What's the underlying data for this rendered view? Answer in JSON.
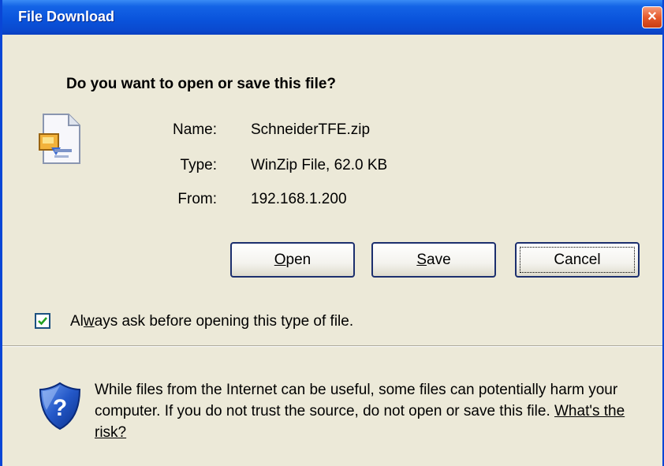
{
  "window": {
    "title": "File Download",
    "close_glyph": "×"
  },
  "dialog": {
    "question": "Do you want to open or save this file?",
    "file_icon": "winzip-file-icon",
    "fields": {
      "name_label": "Name:",
      "name_value": "SchneiderTFE.zip",
      "type_label": "Type:",
      "type_value": "WinZip File, 62.0 KB",
      "from_label": "From:",
      "from_value": "192.168.1.200"
    }
  },
  "buttons": {
    "open_pre": "",
    "open_mnemonic": "O",
    "open_post": "pen",
    "save_pre": "",
    "save_mnemonic": "S",
    "save_post": "ave",
    "cancel_label": "Cancel"
  },
  "always_ask": {
    "checked": true,
    "label_pre": "Al",
    "label_mnemonic": "w",
    "label_post": "ays ask before opening this type of file."
  },
  "warning": {
    "icon": "security-shield-icon",
    "text": "While files from the Internet can be useful, some files can potentially harm your computer. If you do not trust the source, do not open or save this file. ",
    "link": "What's the risk?"
  },
  "colors": {
    "title_bar": "#0a54dc",
    "dialog_bg": "#ece9d8",
    "close_button": "#e55a2c",
    "button_border": "#1c2f6e"
  }
}
